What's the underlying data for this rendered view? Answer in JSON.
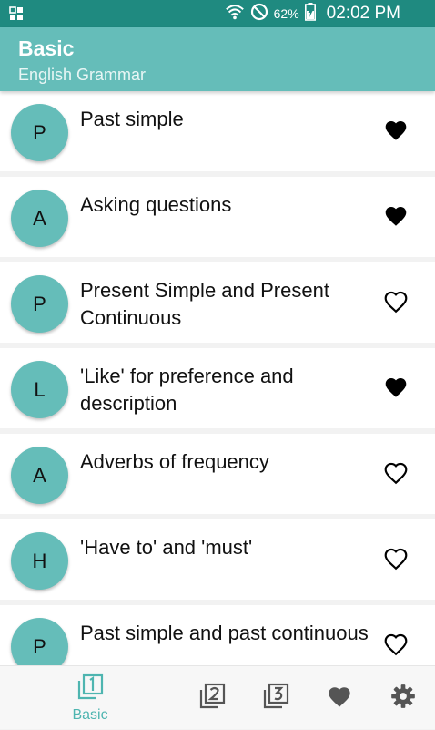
{
  "status_bar": {
    "battery_percent": "62%",
    "time": "02:02 PM"
  },
  "app_bar": {
    "title": "Basic",
    "subtitle": "English Grammar"
  },
  "items": [
    {
      "letter": "P",
      "title": "Past simple",
      "favorite": true
    },
    {
      "letter": "A",
      "title": "Asking questions",
      "favorite": true
    },
    {
      "letter": "P",
      "title": "Present Simple and Present Continuous",
      "favorite": false
    },
    {
      "letter": "L",
      "title": "'Like' for preference and description",
      "favorite": true
    },
    {
      "letter": "A",
      "title": "Adverbs of frequency",
      "favorite": false
    },
    {
      "letter": "H",
      "title": "'Have to' and 'must'",
      "favorite": false
    },
    {
      "letter": "P",
      "title": "Past simple and past continuous",
      "favorite": false
    }
  ],
  "bottom_nav": {
    "active_label": "Basic",
    "items": [
      "level-1-icon",
      "level-2-icon",
      "level-3-icon",
      "favorites-icon",
      "settings-icon"
    ]
  },
  "colors": {
    "status_bar": "#1f8a80",
    "app_bar": "#65bdb9",
    "accent": "#4eb5b0",
    "inactive_icon": "#555555"
  }
}
